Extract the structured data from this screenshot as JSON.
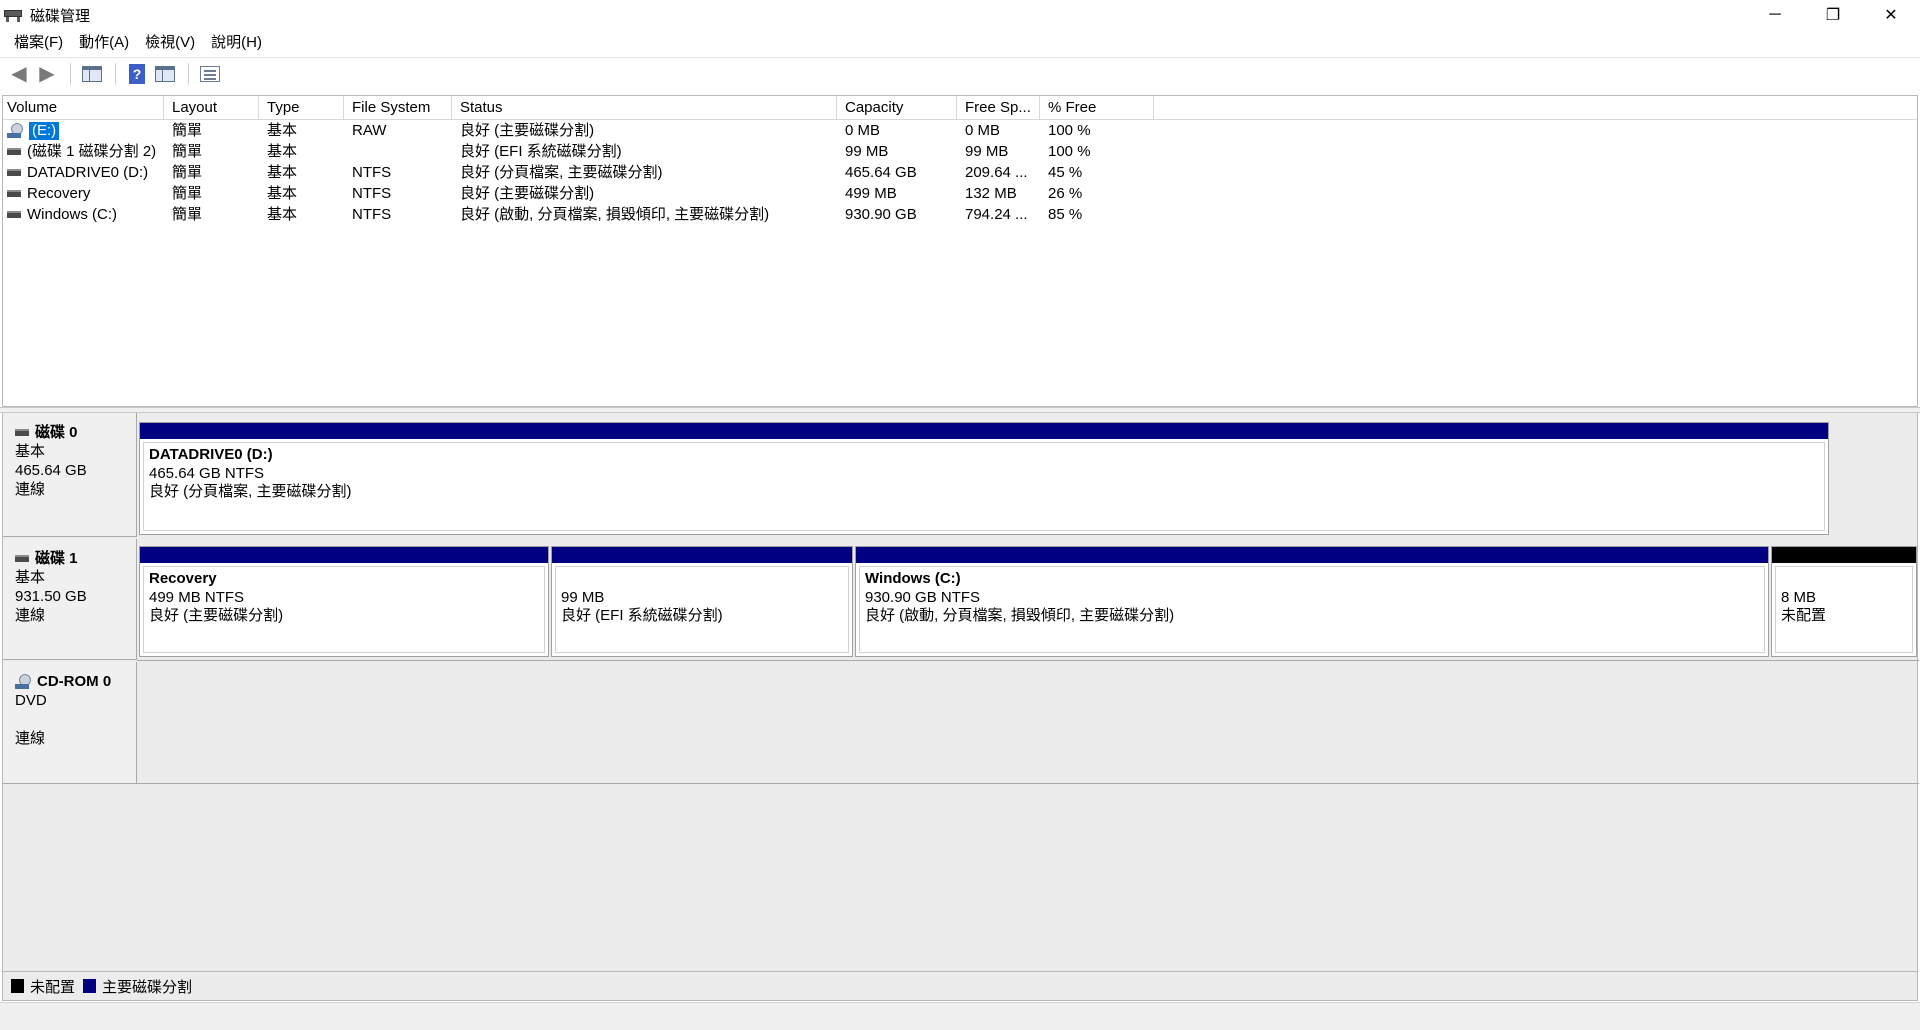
{
  "window": {
    "title": "磁碟管理",
    "controls": {
      "minimize": "─",
      "restore": "❐",
      "close": "✕"
    }
  },
  "menu": [
    {
      "label": "檔案(F)"
    },
    {
      "label": "動作(A)"
    },
    {
      "label": "檢視(V)"
    },
    {
      "label": "說明(H)"
    }
  ],
  "toolbar": {
    "back_icon": "back-arrow-icon",
    "forward_icon": "forward-arrow-icon",
    "help_glyph": "?"
  },
  "volume_list": {
    "columns": [
      "Volume",
      "Layout",
      "Type",
      "File System",
      "Status",
      "Capacity",
      "Free Sp...",
      "% Free"
    ],
    "rows": [
      {
        "volume": "(E:)",
        "layout": "簡單",
        "type": "基本",
        "fs": "RAW",
        "status": "良好 (主要磁碟分割)",
        "capacity": "0 MB",
        "free": "0 MB",
        "pct": "100 %"
      },
      {
        "volume": "(磁碟 1 磁碟分割 2)",
        "layout": "簡單",
        "type": "基本",
        "fs": "",
        "status": "良好 (EFI 系統磁碟分割)",
        "capacity": "99 MB",
        "free": "99 MB",
        "pct": "100 %"
      },
      {
        "volume": "DATADRIVE0 (D:)",
        "layout": "簡單",
        "type": "基本",
        "fs": "NTFS",
        "status": "良好 (分頁檔案, 主要磁碟分割)",
        "capacity": "465.64 GB",
        "free": "209.64 ...",
        "pct": "45 %"
      },
      {
        "volume": "Recovery",
        "layout": "簡單",
        "type": "基本",
        "fs": "NTFS",
        "status": "良好 (主要磁碟分割)",
        "capacity": "499 MB",
        "free": "132 MB",
        "pct": "26 %"
      },
      {
        "volume": "Windows (C:)",
        "layout": "簡單",
        "type": "基本",
        "fs": "NTFS",
        "status": "良好 (啟動, 分頁檔案, 損毀傾印, 主要磁碟分割)",
        "capacity": "930.90 GB",
        "free": "794.24 ...",
        "pct": "85 %"
      }
    ]
  },
  "disks": [
    {
      "name": "磁碟 0",
      "type": "基本",
      "size": "465.64 GB",
      "state": "連線",
      "partitions": [
        {
          "title": "DATADRIVE0  (D:)",
          "size": "465.64 GB NTFS",
          "status": "良好 (分頁檔案, 主要磁碟分割)"
        }
      ]
    },
    {
      "name": "磁碟 1",
      "type": "基本",
      "size": "931.50 GB",
      "state": "連線",
      "partitions": [
        {
          "title": "Recovery",
          "size": "499 MB NTFS",
          "status": "良好 (主要磁碟分割)"
        },
        {
          "title": "",
          "size": "99 MB",
          "status": "良好 (EFI 系統磁碟分割)"
        },
        {
          "title": "Windows  (C:)",
          "size": "930.90 GB NTFS",
          "status": "良好 (啟動, 分頁檔案, 損毀傾印, 主要磁碟分割)"
        },
        {
          "title": "",
          "size": "8 MB",
          "status": "未配置"
        }
      ]
    },
    {
      "name": "CD-ROM 0",
      "type": "DVD",
      "state": "連線"
    }
  ],
  "legend": [
    {
      "label": "未配置",
      "color": "#000000"
    },
    {
      "label": "主要磁碟分割",
      "color": "#000080"
    }
  ],
  "colors": {
    "primary_partition": "#000080",
    "unallocated": "#000000",
    "selection": "#0078d7"
  }
}
